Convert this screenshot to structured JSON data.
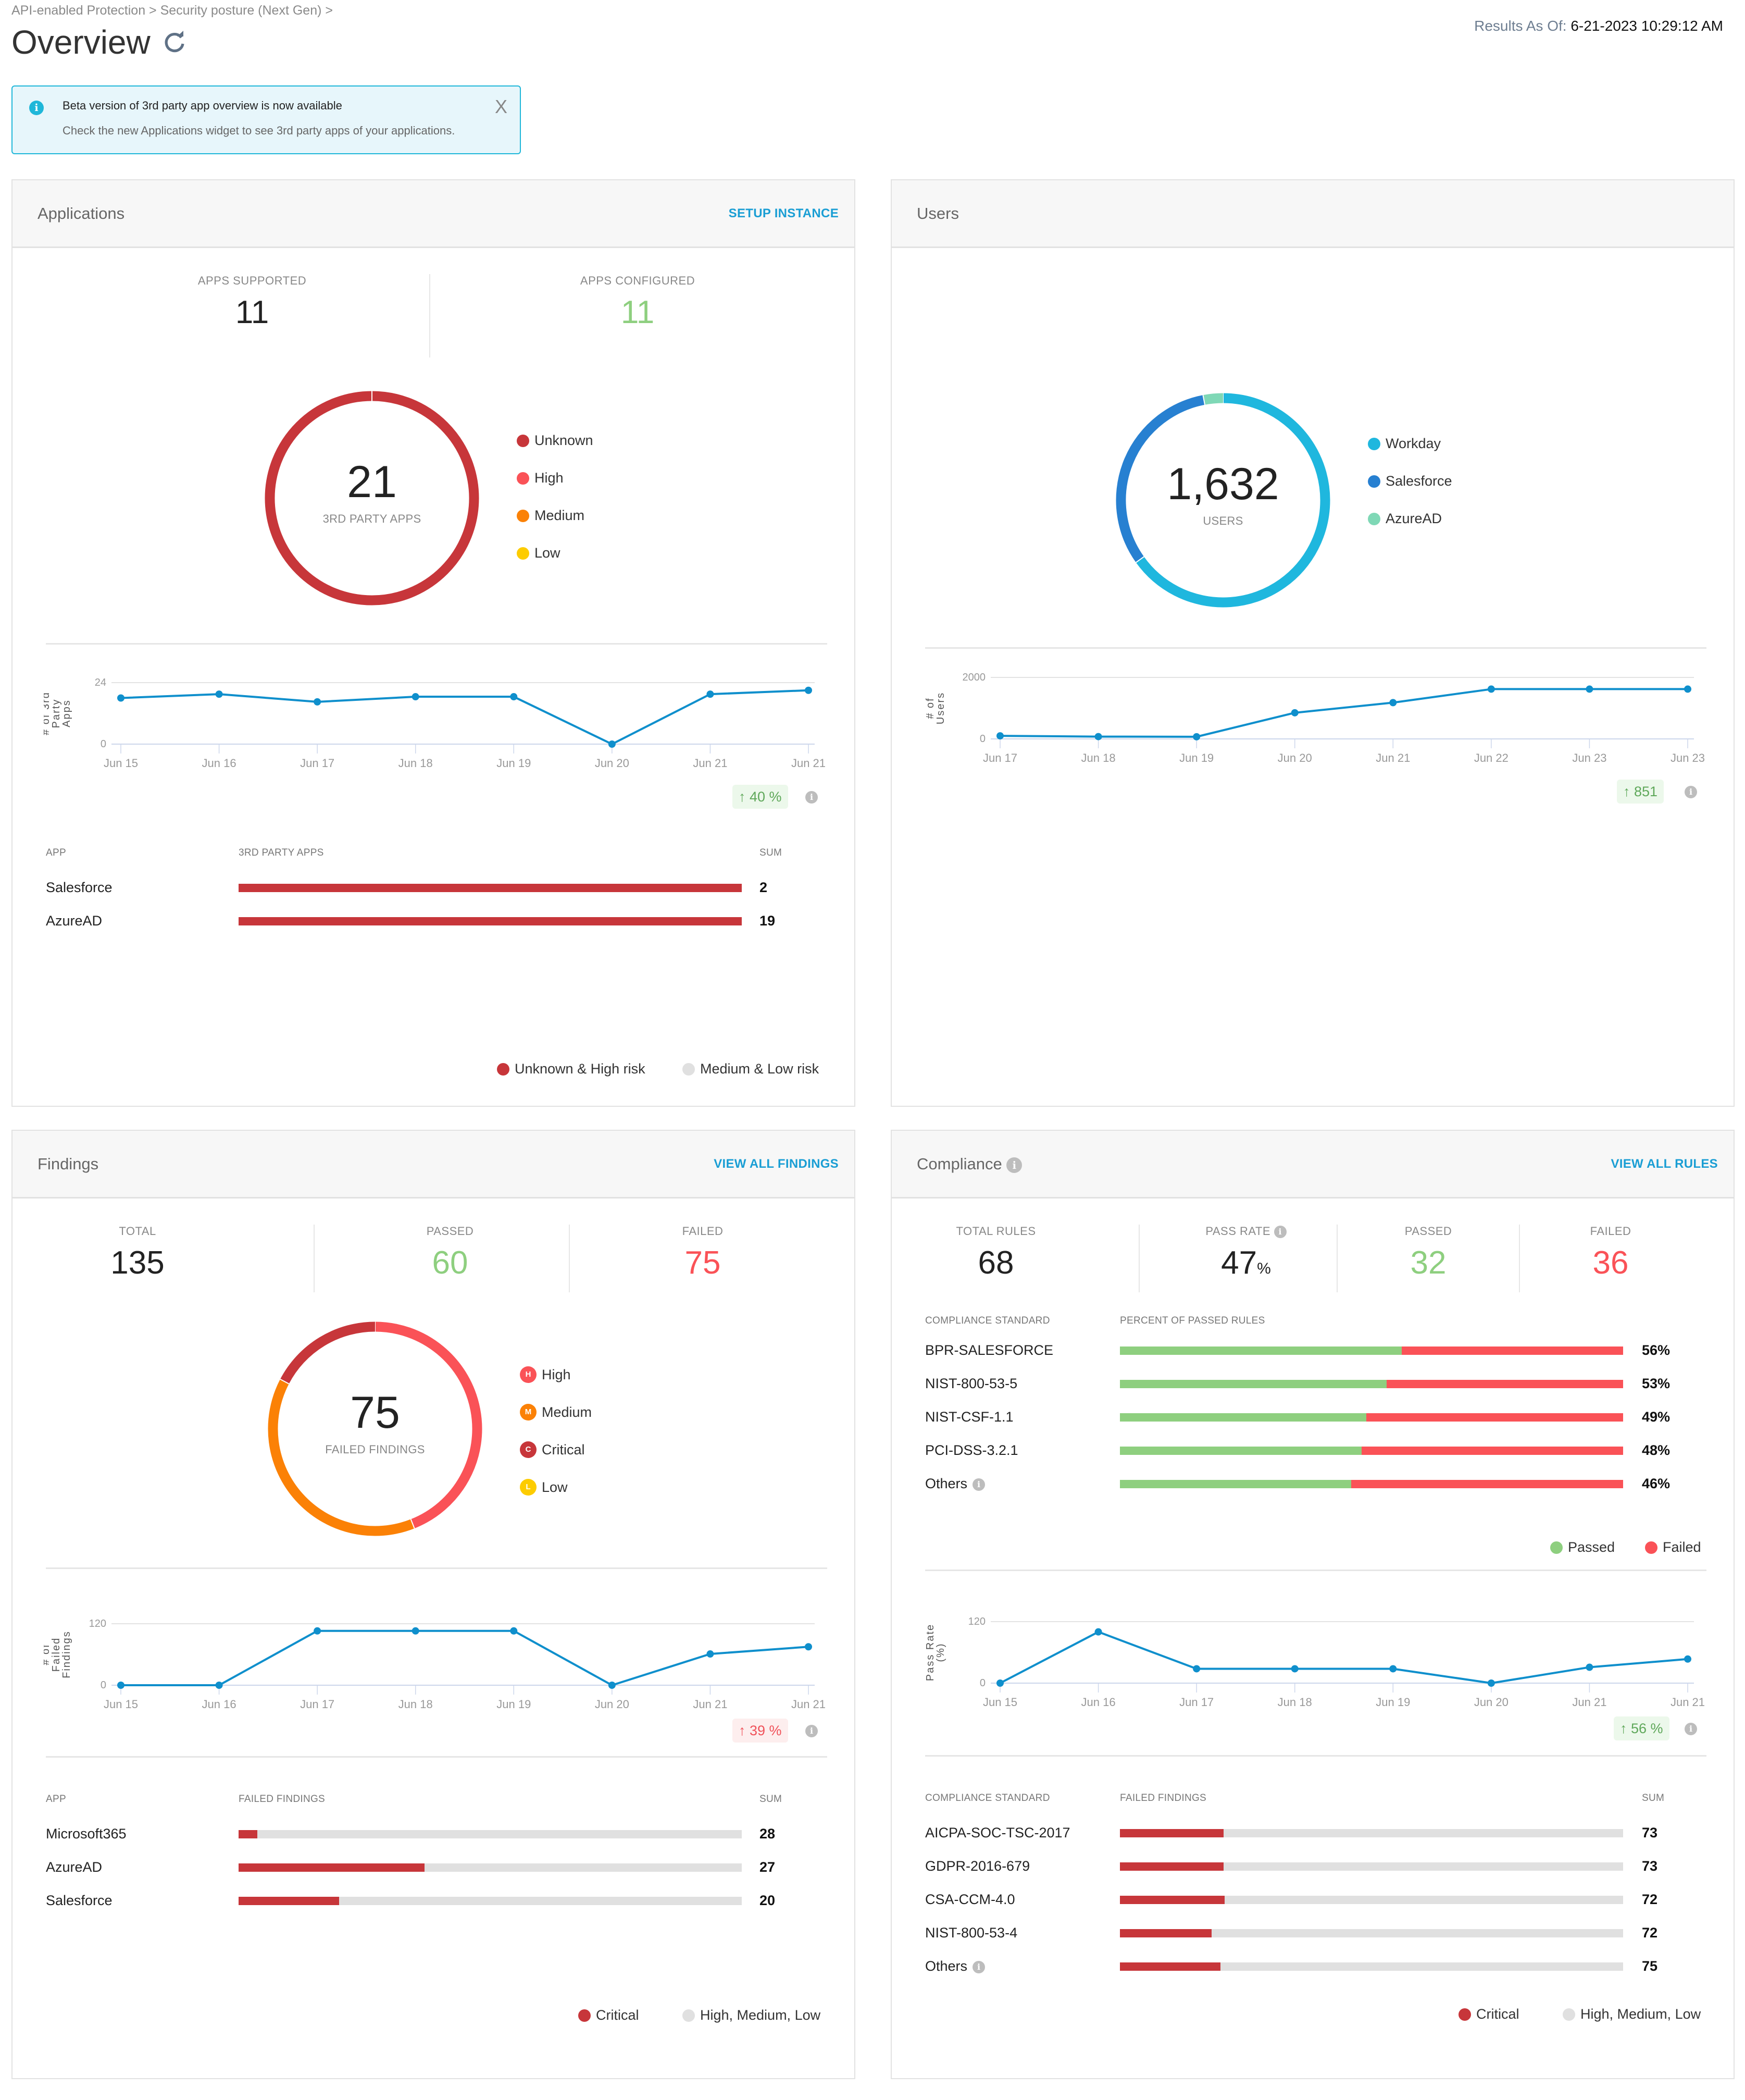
{
  "header": {
    "breadcrumb": "API-enabled Protection > Security posture (Next Gen) >",
    "title": "Overview",
    "results_label": "Results As Of:",
    "results_value": "6-21-2023 10:29:12 AM"
  },
  "banner": {
    "title": "Beta version of 3rd party app overview is now available",
    "text": "Check the new Applications widget to see 3rd party apps of your applications.",
    "close": "X"
  },
  "colors": {
    "accent": "#1a9ed4",
    "line": "#0f8fcc",
    "critical": "#c7363a",
    "high": "#fa5257",
    "medium": "#fb8106",
    "low": "#fdcc00",
    "passed": "#8ecf7f",
    "failed": "#fa5257",
    "workday": "#1fb7de",
    "salesforce": "#2780d1",
    "azuread": "#7fd8b6",
    "neutral": "#e0e0e0"
  },
  "applications": {
    "title": "Applications",
    "link": "SETUP INSTANCE",
    "stats": [
      {
        "label": "APPS SUPPORTED",
        "value": "11"
      },
      {
        "label": "APPS CONFIGURED",
        "value": "11"
      }
    ],
    "donut": {
      "total": "21",
      "label": "3RD PARTY APPS",
      "legend": [
        "Unknown",
        "High",
        "Medium",
        "Low"
      ]
    },
    "table": {
      "headers": [
        "APP",
        "3RD PARTY APPS",
        "SUM"
      ],
      "rows": [
        {
          "app": "Salesforce",
          "sum": "2",
          "fraction": 1.0
        },
        {
          "app": "AzureAD",
          "sum": "19",
          "fraction": 1.0
        }
      ]
    },
    "bottom_legend": [
      "Unknown & High risk",
      "Medium & Low risk"
    ],
    "trend": {
      "arrow": "↑",
      "value": "40 %"
    }
  },
  "users": {
    "title": "Users",
    "donut": {
      "total": "1,632",
      "label": "USERS",
      "legend": [
        "Workday",
        "Salesforce",
        "AzureAD"
      ]
    },
    "trend": {
      "arrow": "↑",
      "value": "851"
    }
  },
  "findings": {
    "title": "Findings",
    "link": "VIEW ALL FINDINGS",
    "stats": [
      {
        "label": "TOTAL",
        "value": "135"
      },
      {
        "label": "PASSED",
        "value": "60"
      },
      {
        "label": "FAILED",
        "value": "75"
      }
    ],
    "donut": {
      "total": "75",
      "label": "FAILED FINDINGS",
      "legend": [
        {
          "letter": "H",
          "label": "High"
        },
        {
          "letter": "M",
          "label": "Medium"
        },
        {
          "letter": "C",
          "label": "Critical"
        },
        {
          "letter": "L",
          "label": "Low"
        }
      ]
    },
    "table": {
      "headers": [
        "APP",
        "FAILED FINDINGS",
        "SUM"
      ],
      "rows": [
        {
          "app": "Microsoft365",
          "sum": "28",
          "critical_fraction": 0.037
        },
        {
          "app": "AzureAD",
          "sum": "27",
          "critical_fraction": 0.37
        },
        {
          "app": "Salesforce",
          "sum": "20",
          "critical_fraction": 0.2
        }
      ]
    },
    "bottom_legend": [
      "Critical",
      "High, Medium, Low"
    ],
    "trend": {
      "arrow": "↑",
      "value": "39 %"
    }
  },
  "compliance": {
    "title": "Compliance",
    "link": "VIEW ALL RULES",
    "stats": [
      {
        "label": "TOTAL RULES",
        "value": "68"
      },
      {
        "label": "PASS RATE",
        "value": "47",
        "unit": "%"
      },
      {
        "label": "PASSED",
        "value": "32"
      },
      {
        "label": "FAILED",
        "value": "36"
      }
    ],
    "pass_table": {
      "headers": [
        "COMPLIANCE STANDARD",
        "PERCENT OF PASSED RULES"
      ],
      "rows": [
        {
          "name": "BPR-SALESFORCE",
          "pct": "56%",
          "value": 56
        },
        {
          "name": "NIST-800-53-5",
          "pct": "53%",
          "value": 53
        },
        {
          "name": "NIST-CSF-1.1",
          "pct": "49%",
          "value": 49
        },
        {
          "name": "PCI-DSS-3.2.1",
          "pct": "48%",
          "value": 48
        },
        {
          "name": "Others",
          "pct": "46%",
          "value": 46,
          "info": true
        }
      ],
      "legend": [
        "Passed",
        "Failed"
      ]
    },
    "fail_table": {
      "headers": [
        "COMPLIANCE STANDARD",
        "FAILED FINDINGS",
        "SUM"
      ],
      "rows": [
        {
          "name": "AICPA-SOC-TSC-2017",
          "sum": "73",
          "critical_fraction": 0.206
        },
        {
          "name": "GDPR-2016-679",
          "sum": "73",
          "critical_fraction": 0.206
        },
        {
          "name": "CSA-CCM-4.0",
          "sum": "72",
          "critical_fraction": 0.208
        },
        {
          "name": "NIST-800-53-4",
          "sum": "72",
          "critical_fraction": 0.182
        },
        {
          "name": "Others",
          "sum": "75",
          "critical_fraction": 0.2,
          "info": true
        }
      ]
    },
    "bottom_legend": [
      "Critical",
      "High, Medium, Low"
    ],
    "trend": {
      "arrow": "↑",
      "value": "56 %"
    }
  },
  "chart_data": [
    {
      "type": "pie",
      "title": "3RD PARTY APPS",
      "categories": [
        "Unknown",
        "High",
        "Medium",
        "Low"
      ],
      "values": [
        21,
        0,
        0,
        0
      ]
    },
    {
      "type": "line",
      "ylabel": "# of 3rd Party Apps",
      "x": [
        "Jun 15",
        "Jun 16",
        "Jun 17",
        "Jun 18",
        "Jun 19",
        "Jun 20",
        "Jun 21",
        "Jun 21"
      ],
      "values": [
        18,
        19.5,
        16.5,
        18.5,
        18.5,
        0,
        19.5,
        21
      ],
      "ylim": [
        0,
        24
      ],
      "yticks": [
        "0",
        "24"
      ]
    },
    {
      "type": "pie",
      "title": "USERS",
      "categories": [
        "Workday",
        "Salesforce",
        "AzureAD"
      ],
      "values": [
        1063,
        520,
        49
      ]
    },
    {
      "type": "line",
      "ylabel": "# of Users",
      "x": [
        "Jun 17",
        "Jun 18",
        "Jun 19",
        "Jun 20",
        "Jun 21",
        "Jun 22",
        "Jun 23",
        "Jun 23"
      ],
      "values": [
        100,
        75,
        70,
        850,
        1180,
        1620,
        1620,
        1620
      ],
      "ylim": [
        0,
        2000
      ],
      "yticks": [
        "0",
        "2000"
      ]
    },
    {
      "type": "pie",
      "title": "FAILED FINDINGS",
      "categories": [
        "High",
        "Medium",
        "Critical",
        "Low"
      ],
      "values": [
        33,
        29,
        13,
        0
      ]
    },
    {
      "type": "line",
      "ylabel": "# of Failed Findings",
      "x": [
        "Jun 15",
        "Jun 16",
        "Jun 17",
        "Jun 18",
        "Jun 19",
        "Jun 20",
        "Jun 21",
        "Jun 21"
      ],
      "values": [
        0,
        0,
        106,
        106,
        106,
        0,
        61,
        75
      ],
      "ylim": [
        0,
        120
      ],
      "yticks": [
        "0",
        "120"
      ]
    },
    {
      "type": "line",
      "ylabel": "Pass Rate (%)",
      "x": [
        "Jun 15",
        "Jun 16",
        "Jun 17",
        "Jun 18",
        "Jun 19",
        "Jun 20",
        "Jun 21",
        "Jun 21"
      ],
      "values": [
        0,
        100,
        28,
        28,
        28,
        0,
        31,
        47
      ],
      "ylim": [
        0,
        120
      ],
      "yticks": [
        "0",
        "120"
      ]
    }
  ]
}
